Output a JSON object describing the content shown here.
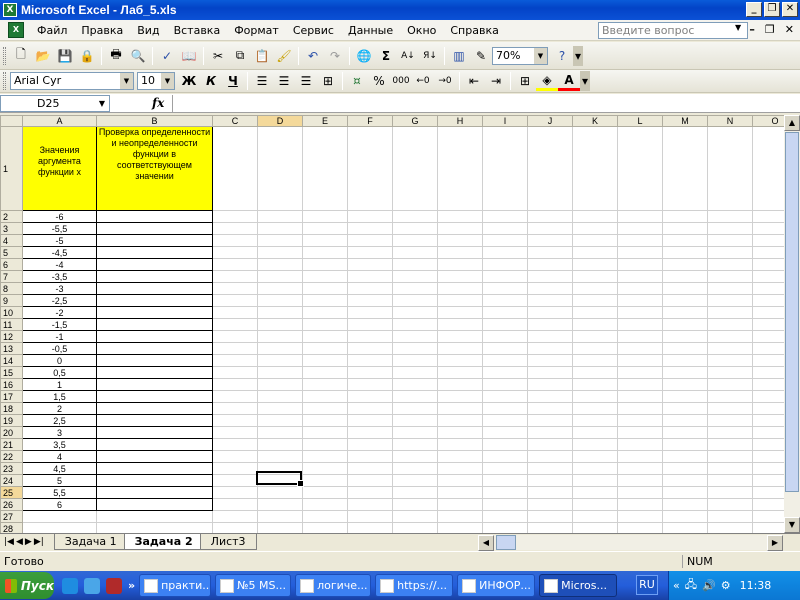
{
  "window": {
    "title": "Microsoft Excel - Лаб_5.xls",
    "app_icon_label": "X"
  },
  "menu": {
    "items": [
      "Файл",
      "Правка",
      "Вид",
      "Вставка",
      "Формат",
      "Сервис",
      "Данные",
      "Окно",
      "Справка"
    ],
    "ask_placeholder": "Введите вопрос"
  },
  "toolbar": {
    "zoom": "70%"
  },
  "format_toolbar": {
    "font": "Arial Cyr",
    "size": "10",
    "bold": "Ж",
    "italic": "К",
    "underline": "Ч"
  },
  "formula_bar": {
    "name_box": "D25",
    "fx": "fx",
    "content": ""
  },
  "sheet": {
    "columns": [
      "A",
      "B",
      "C",
      "D",
      "E",
      "F",
      "G",
      "H",
      "I",
      "J",
      "K",
      "L",
      "M",
      "N",
      "O"
    ],
    "header_a": "Значения аргумента функции х",
    "header_b": "Проверка определенности и неопределенности функции в соответствующем значении",
    "values": [
      "-6",
      "-5,5",
      "-5",
      "-4,5",
      "-4",
      "-3,5",
      "-3",
      "-2,5",
      "-2",
      "-1,5",
      "-1",
      "-0,5",
      "0",
      "0,5",
      "1",
      "1,5",
      "2",
      "2,5",
      "3",
      "3,5",
      "4",
      "4,5",
      "5",
      "5,5",
      "6"
    ],
    "rows_total": 29,
    "selected": "D25"
  },
  "tabs": {
    "items": [
      "Задача 1",
      "Задача 2",
      "Лист3"
    ],
    "active": 1
  },
  "status": {
    "text": "Готово",
    "num": "NUM"
  },
  "taskbar": {
    "start": "Пуск",
    "tasks": [
      "практи...",
      "№5 MS...",
      "логиче...",
      "https://...",
      "ИНФОР...",
      "Micros..."
    ],
    "active_task": 5,
    "lang": "RU",
    "clock": "11:38"
  }
}
